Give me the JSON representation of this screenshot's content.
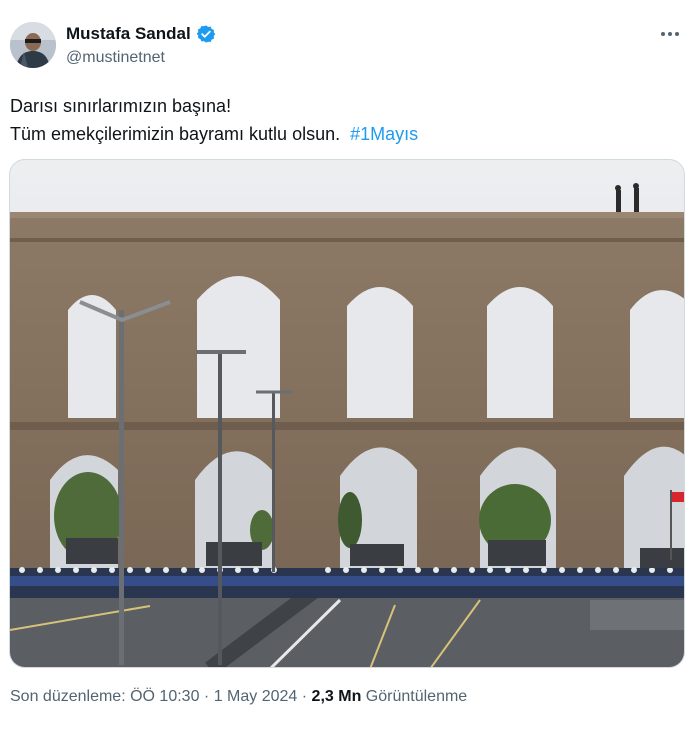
{
  "author": {
    "display_name": "Mustafa Sandal",
    "handle": "@mustinetnet",
    "verified": true,
    "avatar_icon": "avatar-photo"
  },
  "tweet": {
    "line1": "Darısı sınırlarımızın başına!",
    "line2_text": "Tüm emekçilerimizin bayramı kutlu olsun.",
    "hashtag": "#1Mayıs"
  },
  "meta": {
    "edited_label": "Son düzenleme:",
    "time": "ÖÖ 10:30",
    "separator": "·",
    "date": "1 May 2024",
    "views_count": "2,3 Mn",
    "views_label": "Görüntülenme"
  },
  "colors": {
    "accent": "#1d9bf0",
    "text_primary": "#0f1419",
    "text_secondary": "#536471"
  },
  "icons": {
    "verified": "verified-badge-icon",
    "more": "more-options-icon"
  }
}
